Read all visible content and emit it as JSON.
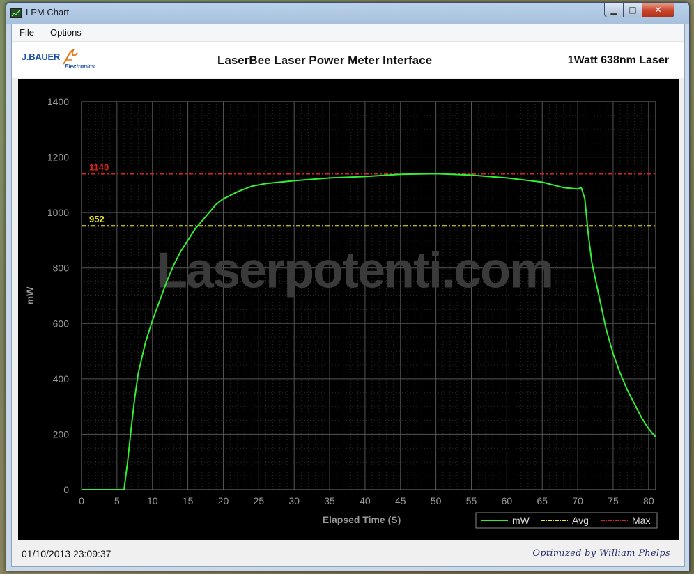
{
  "window": {
    "title": "LPM Chart"
  },
  "menu": {
    "items": [
      "File",
      "Options"
    ]
  },
  "header": {
    "logo_name": "J.BAUER",
    "logo_sub": "Electronics",
    "title": "LaserBee Laser Power Meter Interface",
    "laser": "1Watt 638nm Laser"
  },
  "watermark": "Laserpotenti.com",
  "status": {
    "timestamp": "01/10/2013 23:09:37",
    "signature": "Optimized by William Phelps"
  },
  "colors": {
    "series": "#33ee33",
    "avg": "#eeee22",
    "max": "#dd2222",
    "grid": "#555555",
    "background": "#000000"
  },
  "chart_data": {
    "type": "line",
    "xlabel": "Elapsed Time (S)",
    "ylabel": "mW",
    "xlim": [
      0,
      81
    ],
    "ylim": [
      0,
      1400
    ],
    "xticks": [
      0,
      5,
      10,
      15,
      20,
      25,
      30,
      35,
      40,
      45,
      50,
      55,
      60,
      65,
      70,
      75,
      80
    ],
    "yticks": [
      0,
      200,
      400,
      600,
      800,
      1000,
      1200,
      1400
    ],
    "grid": true,
    "legend_position": "bottom-right",
    "series": [
      {
        "name": "mW",
        "x": [
          0,
          5,
          6,
          6.5,
          7,
          7.5,
          8,
          9,
          10,
          11,
          12,
          13,
          14,
          15,
          16,
          17,
          18,
          19,
          20,
          22,
          24,
          26,
          28,
          30,
          35,
          40,
          45,
          50,
          55,
          60,
          65,
          68,
          70,
          70.5,
          71,
          71.5,
          72,
          73,
          74,
          75,
          76,
          77,
          78,
          79,
          80,
          81
        ],
        "y": [
          0,
          0,
          0,
          100,
          220,
          330,
          420,
          530,
          610,
          680,
          750,
          810,
          860,
          900,
          940,
          970,
          1000,
          1030,
          1050,
          1075,
          1095,
          1105,
          1110,
          1115,
          1125,
          1130,
          1138,
          1140,
          1135,
          1125,
          1110,
          1090,
          1085,
          1090,
          1050,
          920,
          820,
          700,
          580,
          490,
          420,
          360,
          310,
          260,
          220,
          190
        ]
      },
      {
        "name": "Avg",
        "value": 952,
        "label": "952"
      },
      {
        "name": "Max",
        "value": 1140,
        "label": "1140"
      }
    ]
  }
}
